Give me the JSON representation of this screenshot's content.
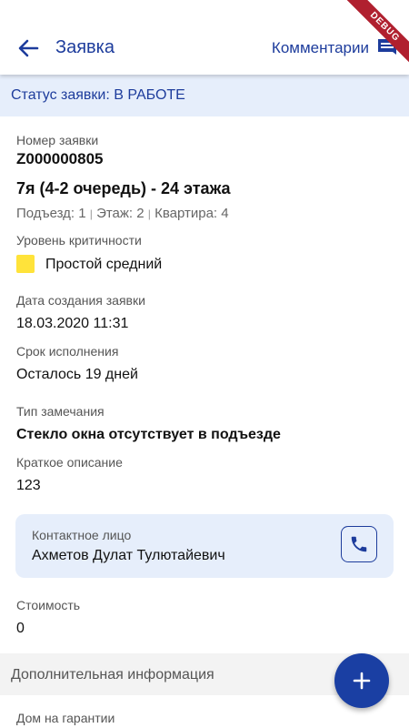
{
  "header": {
    "title": "Заявка",
    "comments_label": "Комментарии"
  },
  "debug_banner": "DEBUG",
  "status": {
    "text": "Статус заявки: В РАБОТЕ"
  },
  "request": {
    "number_label": "Номер заявки",
    "number": "Z000000805",
    "building": "7я (4-2 очередь) - 24 этажа",
    "entrance": "Подъезд: 1",
    "floor": "Этаж: 2",
    "apartment": "Квартира: 4",
    "separator": "|",
    "criticality_label": "Уровень критичности",
    "criticality_value": "Простой средний",
    "criticality_color": "#ffe33a",
    "created_label": "Дата создания заявки",
    "created_value": "18.03.2020 11:31",
    "deadline_label": "Срок исполнения",
    "deadline_value": "Осталось 19 дней",
    "type_label": "Тип замечания",
    "type_value": "Стекло окна отсутствует в подъезде",
    "description_label": "Краткое описание",
    "description_value": "123",
    "cost_label": "Стоимость",
    "cost_value": "0",
    "warranty_label": "Дом на гарантии"
  },
  "contact": {
    "label": "Контактное лицо",
    "name": "Ахметов Дулат Тулютайевич",
    "call_icon": "phone-icon"
  },
  "additional": {
    "label": "Дополнительная информация"
  },
  "colors": {
    "primary": "#1d3c9c",
    "fab": "#1a3fa3",
    "status_bg": "#e6eefb",
    "debug": "#b0202f"
  }
}
